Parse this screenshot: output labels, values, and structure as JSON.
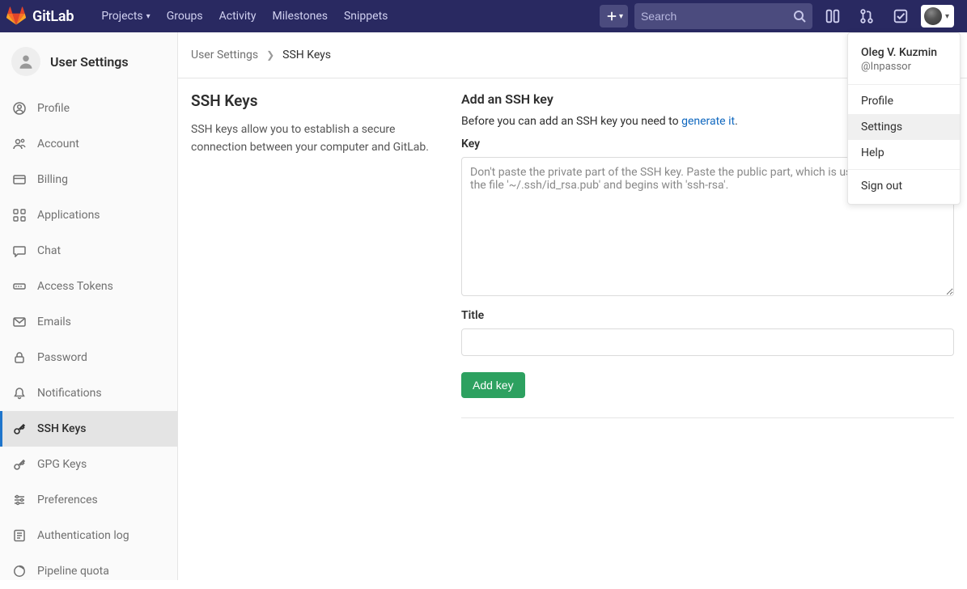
{
  "brand": "GitLab",
  "nav": {
    "projects": "Projects",
    "groups": "Groups",
    "activity": "Activity",
    "milestones": "Milestones",
    "snippets": "Snippets"
  },
  "search": {
    "placeholder": "Search"
  },
  "user_menu": {
    "name": "Oleg V. Kuzmin",
    "handle": "@Inpassor",
    "profile": "Profile",
    "settings": "Settings",
    "help": "Help",
    "sign_out": "Sign out"
  },
  "sidebar": {
    "title": "User Settings",
    "items": [
      {
        "label": "Profile"
      },
      {
        "label": "Account"
      },
      {
        "label": "Billing"
      },
      {
        "label": "Applications"
      },
      {
        "label": "Chat"
      },
      {
        "label": "Access Tokens"
      },
      {
        "label": "Emails"
      },
      {
        "label": "Password"
      },
      {
        "label": "Notifications"
      },
      {
        "label": "SSH Keys"
      },
      {
        "label": "GPG Keys"
      },
      {
        "label": "Preferences"
      },
      {
        "label": "Authentication log"
      },
      {
        "label": "Pipeline quota"
      }
    ]
  },
  "breadcrumb": {
    "root": "User Settings",
    "current": "SSH Keys"
  },
  "page": {
    "heading": "SSH Keys",
    "description": "SSH keys allow you to establish a secure connection between your computer and GitLab.",
    "add_heading": "Add an SSH key",
    "before_text": "Before you can add an SSH key you need to ",
    "generate_link": "generate it",
    "period": ".",
    "key_label": "Key",
    "key_placeholder": "Don't paste the private part of the SSH key. Paste the public part, which is usually contained in the file '~/.ssh/id_rsa.pub' and begins with 'ssh-rsa'.",
    "title_label": "Title",
    "add_button": "Add key"
  }
}
